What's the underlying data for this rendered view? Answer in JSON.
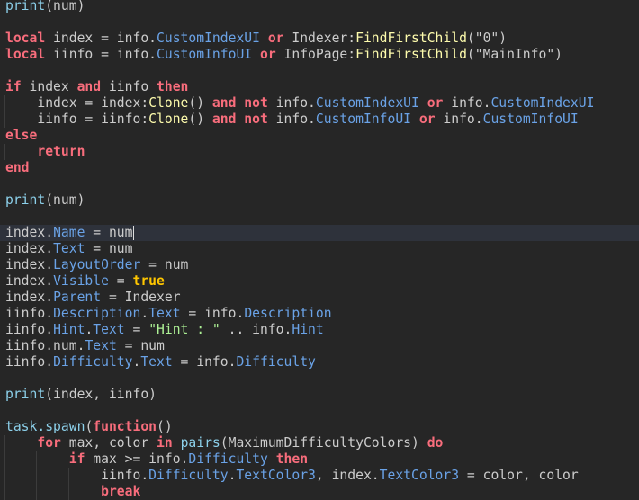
{
  "editor": {
    "active_line": 14,
    "lines": [
      [
        [
          "print",
          "builtin"
        ],
        [
          "(num)",
          "txt"
        ]
      ],
      [],
      [
        [
          "local",
          "kw"
        ],
        [
          " index = info.",
          "txt"
        ],
        [
          "CustomIndexUI",
          "prop"
        ],
        [
          " ",
          "txt"
        ],
        [
          "or",
          "kw"
        ],
        [
          " Indexer:",
          "txt"
        ],
        [
          "FindFirstChild",
          "method"
        ],
        [
          "(\"0\")",
          "txt"
        ]
      ],
      [
        [
          "local",
          "kw"
        ],
        [
          " iinfo = info.",
          "txt"
        ],
        [
          "CustomInfoUI",
          "prop"
        ],
        [
          " ",
          "txt"
        ],
        [
          "or",
          "kw"
        ],
        [
          " InfoPage:",
          "txt"
        ],
        [
          "FindFirstChild",
          "method"
        ],
        [
          "(\"MainInfo\")",
          "txt"
        ]
      ],
      [],
      [
        [
          "if",
          "kw"
        ],
        [
          " index ",
          "txt"
        ],
        [
          "and",
          "kw"
        ],
        [
          " iinfo ",
          "txt"
        ],
        [
          "then",
          "kw"
        ]
      ],
      [
        [
          "    index = index:",
          "txt"
        ],
        [
          "Clone",
          "method"
        ],
        [
          "() ",
          "txt"
        ],
        [
          "and",
          "kw"
        ],
        [
          " ",
          "txt"
        ],
        [
          "not",
          "kw"
        ],
        [
          " info.",
          "txt"
        ],
        [
          "CustomIndexUI",
          "prop"
        ],
        [
          " ",
          "txt"
        ],
        [
          "or",
          "kw"
        ],
        [
          " info.",
          "txt"
        ],
        [
          "CustomIndexUI",
          "prop"
        ]
      ],
      [
        [
          "    iinfo = iinfo:",
          "txt"
        ],
        [
          "Clone",
          "method"
        ],
        [
          "() ",
          "txt"
        ],
        [
          "and",
          "kw"
        ],
        [
          " ",
          "txt"
        ],
        [
          "not",
          "kw"
        ],
        [
          " info.",
          "txt"
        ],
        [
          "CustomInfoUI",
          "prop"
        ],
        [
          " ",
          "txt"
        ],
        [
          "or",
          "kw"
        ],
        [
          " info.",
          "txt"
        ],
        [
          "CustomInfoUI",
          "prop"
        ]
      ],
      [
        [
          "else",
          "kw"
        ]
      ],
      [
        [
          "    ",
          "txt"
        ],
        [
          "return",
          "kw"
        ]
      ],
      [
        [
          "end",
          "kw"
        ]
      ],
      [],
      [
        [
          "print",
          "builtin"
        ],
        [
          "(num)",
          "txt"
        ]
      ],
      [],
      [
        [
          "index.",
          "txt"
        ],
        [
          "Name",
          "prop"
        ],
        [
          " = num",
          "txt"
        ]
      ],
      [
        [
          "index.",
          "txt"
        ],
        [
          "Text",
          "prop"
        ],
        [
          " = num",
          "txt"
        ]
      ],
      [
        [
          "index.",
          "txt"
        ],
        [
          "LayoutOrder",
          "prop"
        ],
        [
          " = num",
          "txt"
        ]
      ],
      [
        [
          "index.",
          "txt"
        ],
        [
          "Visible",
          "prop"
        ],
        [
          " = ",
          "txt"
        ],
        [
          "true",
          "bool"
        ]
      ],
      [
        [
          "index.",
          "txt"
        ],
        [
          "Parent",
          "prop"
        ],
        [
          " = Indexer",
          "txt"
        ]
      ],
      [
        [
          "iinfo.",
          "txt"
        ],
        [
          "Description",
          "prop"
        ],
        [
          ".",
          "txt"
        ],
        [
          "Text",
          "prop"
        ],
        [
          " = info.",
          "txt"
        ],
        [
          "Description",
          "prop"
        ]
      ],
      [
        [
          "iinfo.",
          "txt"
        ],
        [
          "Hint",
          "prop"
        ],
        [
          ".",
          "txt"
        ],
        [
          "Text",
          "prop"
        ],
        [
          " = ",
          "txt"
        ],
        [
          "\"Hint : \"",
          "str"
        ],
        [
          " .. info.",
          "txt"
        ],
        [
          "Hint",
          "prop"
        ]
      ],
      [
        [
          "iinfo.num.",
          "txt"
        ],
        [
          "Text",
          "prop"
        ],
        [
          " = num",
          "txt"
        ]
      ],
      [
        [
          "iinfo.",
          "txt"
        ],
        [
          "Difficulty",
          "prop"
        ],
        [
          ".",
          "txt"
        ],
        [
          "Text",
          "prop"
        ],
        [
          " = info.",
          "txt"
        ],
        [
          "Difficulty",
          "prop"
        ]
      ],
      [],
      [
        [
          "print",
          "builtin"
        ],
        [
          "(index, iinfo)",
          "txt"
        ]
      ],
      [],
      [
        [
          "task.spawn",
          "builtin"
        ],
        [
          "(",
          "txt"
        ],
        [
          "function",
          "kw"
        ],
        [
          "()",
          "txt"
        ]
      ],
      [
        [
          "    ",
          "txt"
        ],
        [
          "for",
          "kw"
        ],
        [
          " max, color ",
          "txt"
        ],
        [
          "in",
          "kw"
        ],
        [
          " ",
          "txt"
        ],
        [
          "pairs",
          "builtin"
        ],
        [
          "(MaximumDifficultyColors) ",
          "txt"
        ],
        [
          "do",
          "kw"
        ]
      ],
      [
        [
          "        ",
          "txt"
        ],
        [
          "if",
          "kw"
        ],
        [
          " max >= info.",
          "txt"
        ],
        [
          "Difficulty",
          "prop"
        ],
        [
          " ",
          "txt"
        ],
        [
          "then",
          "kw"
        ]
      ],
      [
        [
          "            iinfo.",
          "txt"
        ],
        [
          "Difficulty",
          "prop"
        ],
        [
          ".",
          "txt"
        ],
        [
          "TextColor3",
          "prop"
        ],
        [
          ", index.",
          "txt"
        ],
        [
          "TextColor3",
          "prop"
        ],
        [
          " = color, color",
          "txt"
        ]
      ],
      [
        [
          "            ",
          "txt"
        ],
        [
          "break",
          "kw"
        ]
      ]
    ]
  }
}
